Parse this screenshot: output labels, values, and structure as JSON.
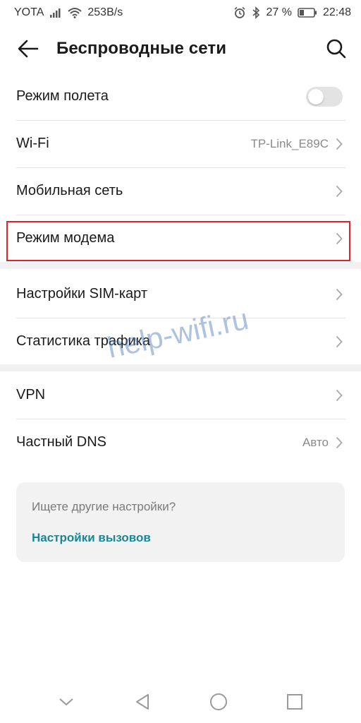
{
  "status_bar": {
    "carrier": "YOTA",
    "speed": "253B/s",
    "battery": "27 %",
    "time": "22:48",
    "icons": [
      "signal-icon",
      "wifi-icon",
      "alarm-icon",
      "bluetooth-icon",
      "battery-icon"
    ]
  },
  "header": {
    "title": "Беспроводные сети",
    "icons": [
      "back-arrow-icon",
      "search-icon"
    ]
  },
  "groups": [
    {
      "rows": [
        {
          "label": "Режим полета",
          "control": "toggle",
          "toggle_on": false
        },
        {
          "label": "Wi-Fi",
          "value": "TP-Link_E89C",
          "control": "chevron"
        },
        {
          "label": "Мобильная сеть",
          "control": "chevron"
        },
        {
          "label": "Режим модема",
          "control": "chevron",
          "highlighted": true
        }
      ]
    },
    {
      "rows": [
        {
          "label": "Настройки SIM-карт",
          "control": "chevron"
        },
        {
          "label": "Статистика трафика",
          "control": "chevron"
        }
      ]
    },
    {
      "rows": [
        {
          "label": "VPN",
          "control": "chevron"
        },
        {
          "label": "Частный DNS",
          "value": "Авто",
          "control": "chevron"
        }
      ]
    }
  ],
  "watermark": "help-wifi.ru",
  "card": {
    "hint": "Ищете другие настройки?",
    "link": "Настройки вызовов"
  },
  "colors": {
    "accent_link": "#1a8796",
    "highlight_border": "#d9262c",
    "band": "#f1f1f1"
  },
  "nav_bar": {
    "icons": [
      "collapse-chevron-icon",
      "back-triangle-icon",
      "home-circle-icon",
      "recents-square-icon"
    ]
  }
}
